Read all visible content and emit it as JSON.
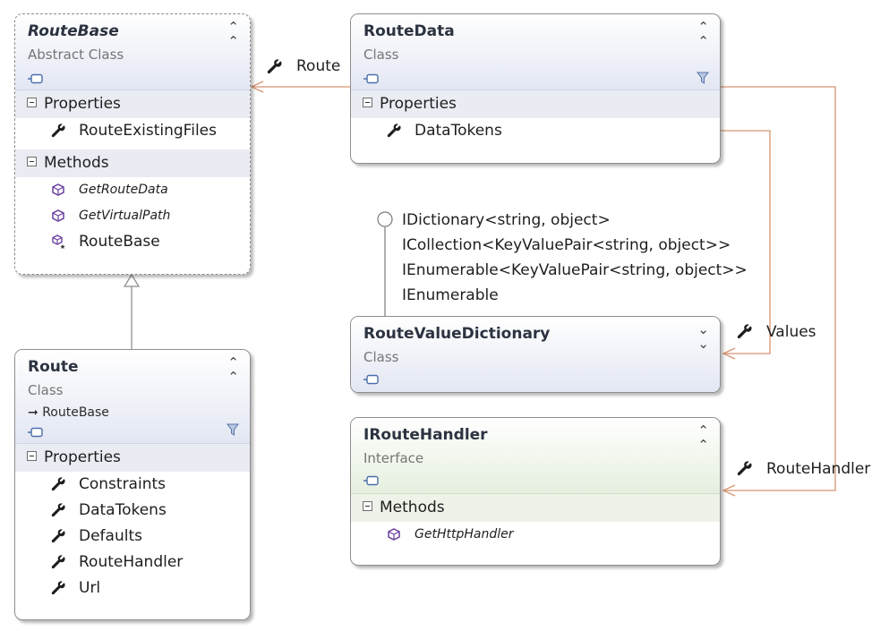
{
  "colors": {
    "association": "#d59570",
    "generalization": "#8a8a8a",
    "lollipop": "#7a7a7a"
  },
  "routebase": {
    "name": "RouteBase",
    "kind": "Abstract Class",
    "sections": {
      "properties": "Properties",
      "methods": "Methods"
    },
    "properties": [
      "RouteExistingFiles"
    ],
    "methods": [
      "GetRouteData",
      "GetVirtualPath"
    ],
    "ctor": "RouteBase"
  },
  "routedata": {
    "name": "RouteData",
    "kind": "Class",
    "sections": {
      "properties": "Properties"
    },
    "properties": [
      "DataTokens"
    ]
  },
  "route": {
    "name": "Route",
    "kind": "Class",
    "inherits": "RouteBase",
    "sections": {
      "properties": "Properties"
    },
    "properties": [
      "Constraints",
      "DataTokens",
      "Defaults",
      "RouteHandler",
      "Url"
    ]
  },
  "rvd": {
    "name": "RouteValueDictionary",
    "kind": "Class",
    "interfaces": [
      "IDictionary<string, object>",
      "ICollection<KeyValuePair<string, object>>",
      "IEnumerable<KeyValuePair<string, object>>",
      "IEnumerable"
    ]
  },
  "iroutehandler": {
    "name": "IRouteHandler",
    "kind": "Interface",
    "sections": {
      "methods": "Methods"
    },
    "methods": [
      "GetHttpHandler"
    ]
  },
  "associations": {
    "route": "Route",
    "values": "Values",
    "routehandler": "RouteHandler"
  }
}
